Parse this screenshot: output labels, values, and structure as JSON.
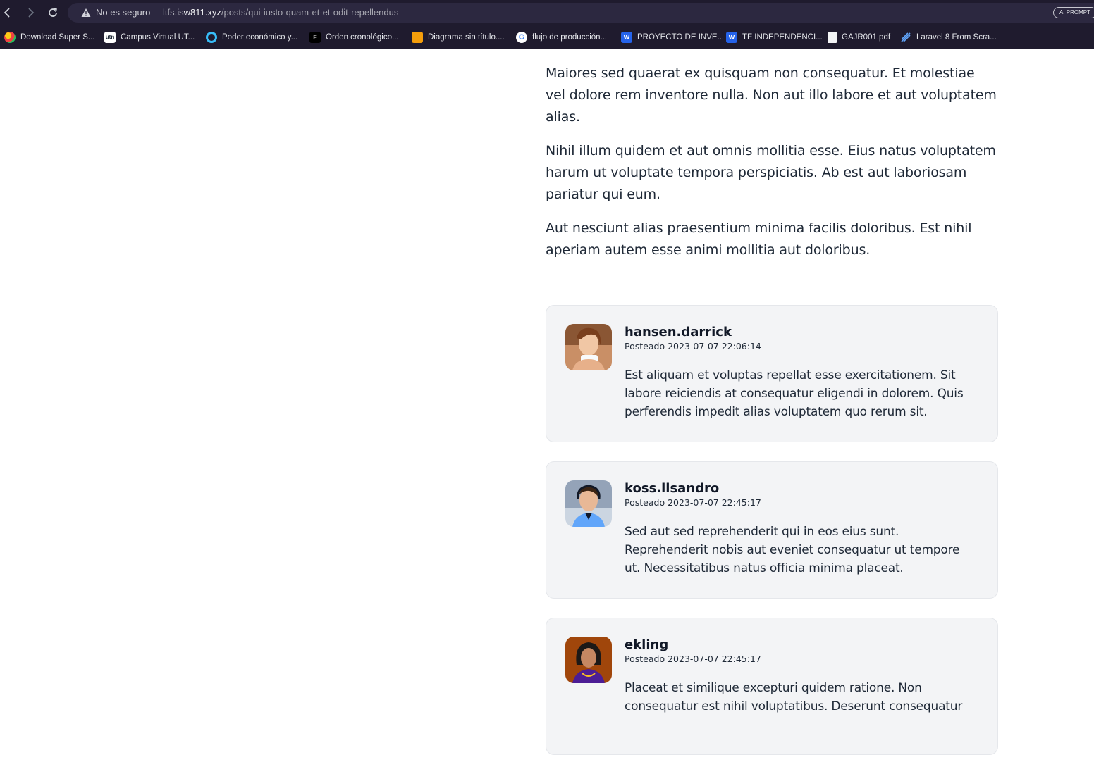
{
  "browser": {
    "security_label": "No es seguro",
    "url_prefix": "ltfs.",
    "url_host": "isw811.xyz",
    "url_path": "/posts/qui-iusto-quam-et-et-odit-repellendus",
    "extension_label": "AI PROMPT",
    "bookmarks": [
      {
        "label": "Download Super S...",
        "icon": "colorful-puzzle-icon",
        "color": "#e11d48"
      },
      {
        "label": "Campus Virtual UT...",
        "icon": "utn-logo-icon",
        "color": "#ffffff"
      },
      {
        "label": "Poder económico y...",
        "icon": "blue-swirl-icon",
        "color": "#38bdf8"
      },
      {
        "label": "Orden cronológico...",
        "icon": "figma-icon",
        "color": "#000000"
      },
      {
        "label": "Diagrama sin título....",
        "icon": "drawio-icon",
        "color": "#f59e0b"
      },
      {
        "label": "flujo de producción...",
        "icon": "google-icon",
        "color": "#ffffff"
      },
      {
        "label": "PROYECTO DE INVE...",
        "icon": "word-icon",
        "color": "#2563eb"
      },
      {
        "label": "TF INDEPENDENCI...",
        "icon": "word-icon",
        "color": "#2563eb"
      },
      {
        "label": "GAJR001.pdf",
        "icon": "document-icon",
        "color": "#f3f4f6"
      },
      {
        "label": "Laravel 8 From Scra...",
        "icon": "laracasts-icon",
        "color": "#60a5fa"
      }
    ]
  },
  "post": {
    "paragraphs": [
      "Maiores sed quaerat ex quisquam non consequatur. Et molestiae vel dolore rem inventore nulla. Non aut illo labore et aut voluptatem alias.",
      "Nihil illum quidem et aut omnis mollitia esse. Eius natus voluptatem harum ut voluptate tempora perspiciatis. Ab est aut laboriosam pariatur qui eum.",
      "Aut nesciunt alias praesentium minima facilis doloribus. Est nihil aperiam autem esse animi mollitia aut doloribus."
    ]
  },
  "comments": [
    {
      "author": "hansen.darrick",
      "posted_prefix": "Posteado",
      "posted_at": "2023-07-07 22:06:14",
      "body": "Est aliquam et voluptas repellat esse exercitationem. Sit labore reiciendis at consequatur eligendi in dolorem. Quis perferendis impedit alias voluptatem quo rerum sit."
    },
    {
      "author": "koss.lisandro",
      "posted_prefix": "Posteado",
      "posted_at": "2023-07-07 22:45:17",
      "body": "Sed aut sed reprehenderit qui in eos eius sunt. Reprehenderit nobis aut eveniet consequatur ut tempore ut. Necessitatibus natus officia minima placeat."
    },
    {
      "author": "ekling",
      "posted_prefix": "Posteado",
      "posted_at": "2023-07-07 22:45:17",
      "body": "Placeat et similique excepturi quidem ratione. Non consequatur est nihil voluptatibus. Deserunt consequatur"
    }
  ]
}
